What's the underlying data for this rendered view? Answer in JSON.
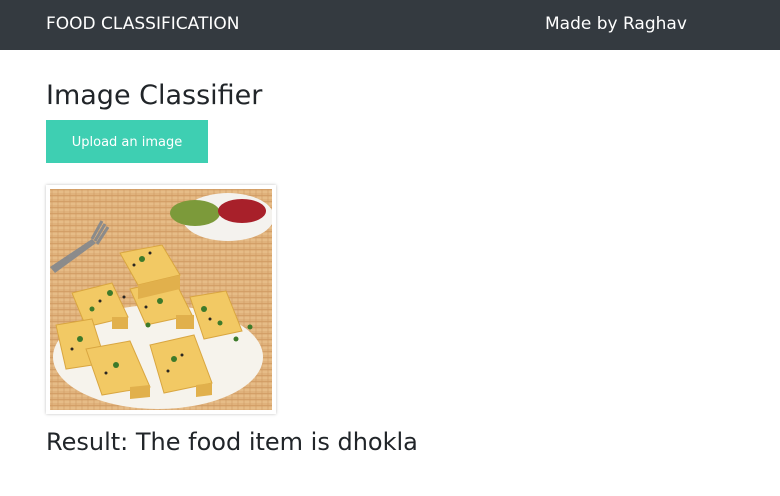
{
  "navbar": {
    "brand": "FOOD CLASSIFICATION",
    "credit": "Made by Raghav"
  },
  "main": {
    "title": "Image Classifier",
    "upload_label": "Upload an image",
    "result": "Result: The food item is dhokla"
  },
  "colors": {
    "navbar_bg": "#343a40",
    "button_bg": "#3ecfb2"
  }
}
